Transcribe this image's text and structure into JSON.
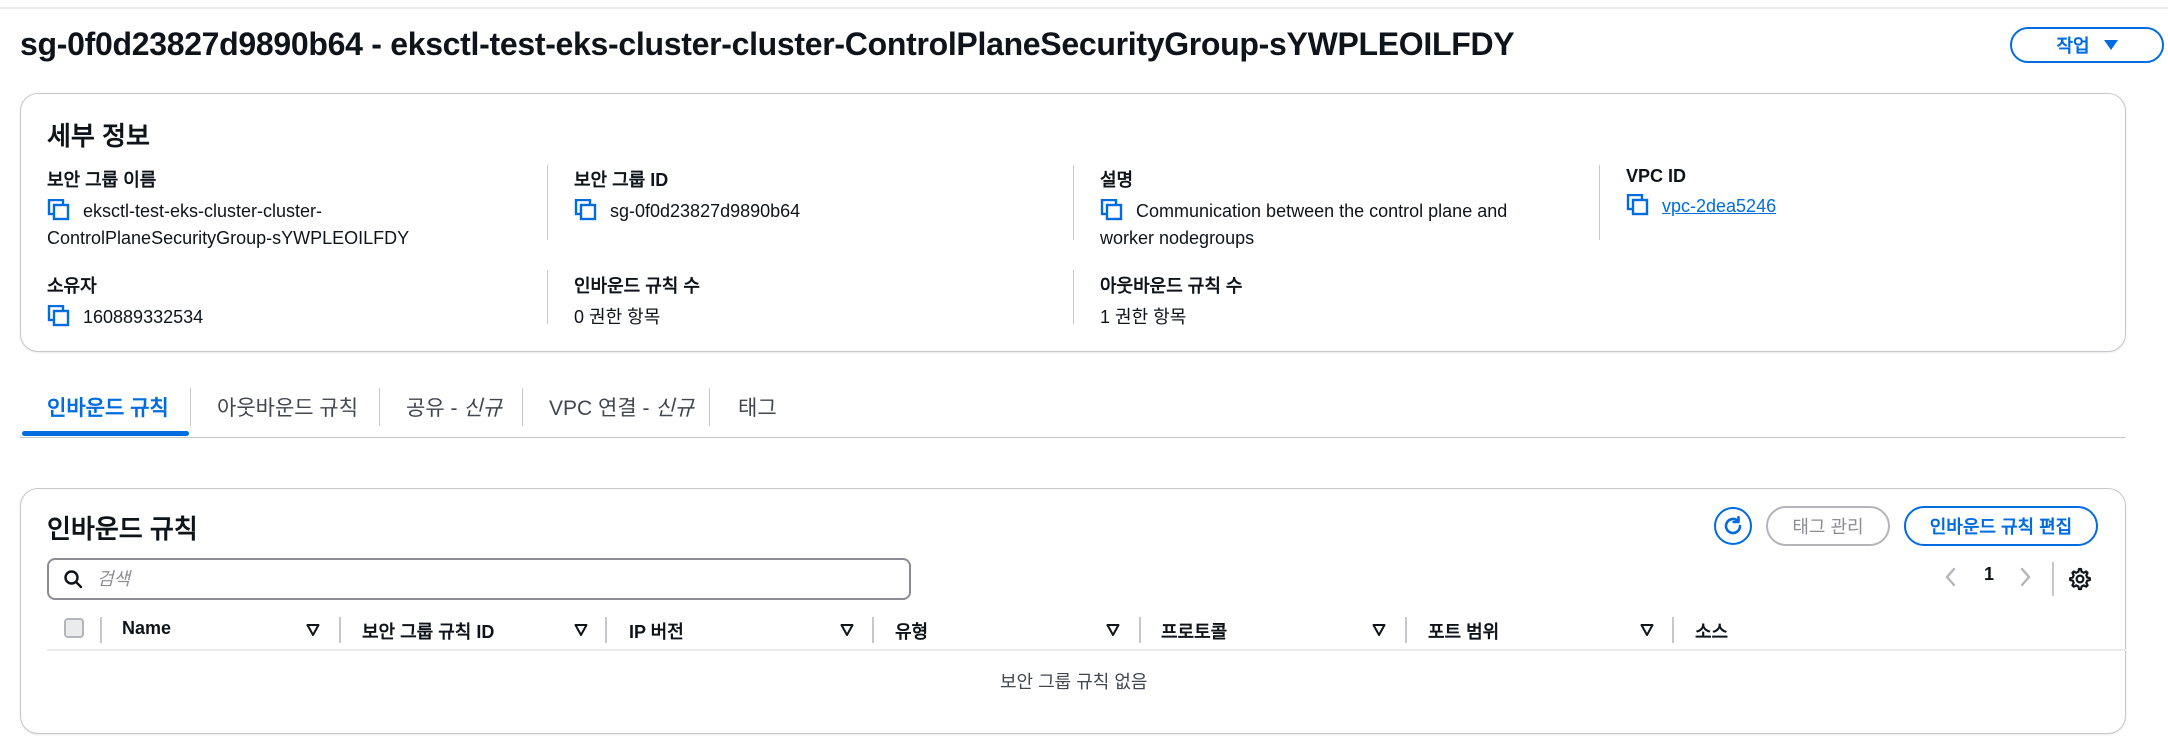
{
  "header": {
    "title": "sg-0f0d23827d9890b64 - eksctl-test-eks-cluster-cluster-ControlPlaneSecurityGroup-sYWPLEOILFDY",
    "actions_label": "작업"
  },
  "details": {
    "heading": "세부 정보",
    "fields": {
      "group_name": {
        "label": "보안 그룹 이름",
        "value_line1": "eksctl-test-eks-cluster-cluster-",
        "value_line2": "ControlPlaneSecurityGroup-sYWPLEOILFDY"
      },
      "group_id": {
        "label": "보안 그룹 ID",
        "value": "sg-0f0d23827d9890b64"
      },
      "description": {
        "label": "설명",
        "value_line1": "Communication between the control plane and",
        "value_line2": "worker nodegroups"
      },
      "vpc_id": {
        "label": "VPC ID",
        "value": "vpc-2dea5246"
      },
      "owner": {
        "label": "소유자",
        "value": "160889332534"
      },
      "inbound_count": {
        "label": "인바운드 규칙 수",
        "value": "0 권한 항목"
      },
      "outbound_count": {
        "label": "아웃바운드 규칙 수",
        "value": "1 권한 항목"
      }
    }
  },
  "tabs": [
    {
      "label": "인바운드 규칙",
      "suffix": "",
      "active": true
    },
    {
      "label": "아웃바운드 규칙",
      "suffix": "",
      "active": false
    },
    {
      "label": "공유 - ",
      "suffix": "신규",
      "active": false
    },
    {
      "label": "VPC 연결 - ",
      "suffix": "신규",
      "active": false
    },
    {
      "label": "태그",
      "suffix": "",
      "active": false
    }
  ],
  "rules": {
    "heading": "인바운드 규칙",
    "manage_tags_label": "태그 관리",
    "edit_label": "인바운드 규칙 편집",
    "search_placeholder": "검색",
    "page": "1",
    "columns": [
      "Name",
      "보안 그룹 규칙 ID",
      "IP 버전",
      "유형",
      "프로토콜",
      "포트 범위",
      "소스"
    ],
    "empty_text": "보안 그룹 규칙 없음"
  },
  "colors": {
    "accent": "#006ce0",
    "border": "#c6c6cd",
    "disabled": "#b4b4bb",
    "text": "#0f141a"
  },
  "icons": [
    "copy-icon",
    "refresh-icon",
    "search-icon",
    "chevron-left-icon",
    "chevron-right-icon",
    "settings-gear-icon",
    "sort-icon",
    "caret-down-icon"
  ]
}
